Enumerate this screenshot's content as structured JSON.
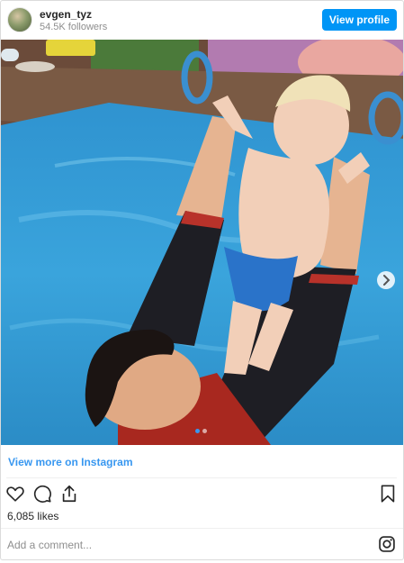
{
  "post": {
    "username": "evgen_tyz",
    "followers": "54.5K followers",
    "view_profile_label": "View profile",
    "view_more_label": "View more on Instagram",
    "likes": "6,085 likes",
    "comment_placeholder": "Add a comment...",
    "carousel": {
      "total": 2,
      "current": 1
    }
  },
  "colors": {
    "accent": "#0095f6",
    "link": "#3897f0",
    "pool_water": "#3aa0d8",
    "pool_edge": "#7a5a44"
  },
  "icons": [
    "heart-icon",
    "comment-icon",
    "share-icon",
    "bookmark-icon",
    "instagram-icon",
    "chevron-right-icon"
  ]
}
